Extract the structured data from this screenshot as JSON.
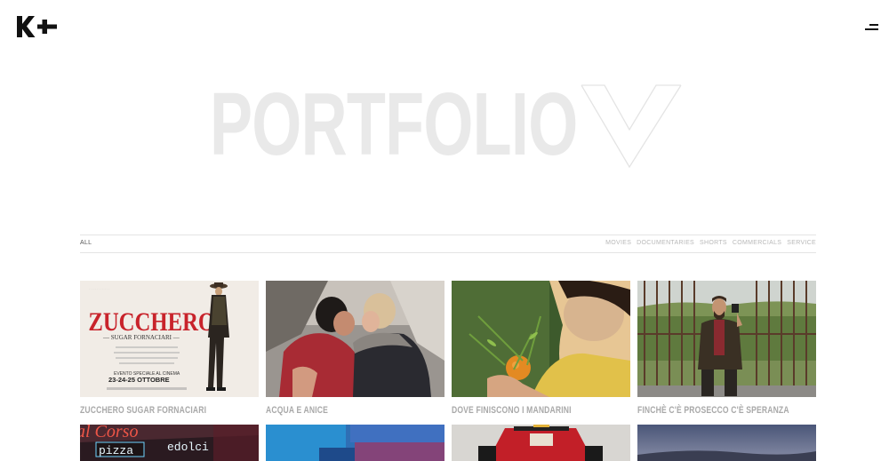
{
  "header": {
    "logo_alt": "K+",
    "menu_icon": "hamburger-icon"
  },
  "hero": {
    "title": "PORTFOLIO"
  },
  "filters": {
    "active": "ALL",
    "items": [
      "MOVIES",
      "DOCUMENTARIES",
      "SHORTS",
      "COMMERCIALS",
      "SERVICE"
    ]
  },
  "portfolio": {
    "items": [
      {
        "title": "ZUCCHERO SUGAR FORNACIARI",
        "poster": {
          "heading": "ZUCCHERO",
          "subheading": "— SUGAR FORNACIARI —",
          "event": "EVENTO SPECIALE AL CINEMA",
          "dates": "23-24-25 OTTOBRE"
        }
      },
      {
        "title": "ACQUA E ANICE"
      },
      {
        "title": "DOVE FINISCONO I MANDARINI"
      },
      {
        "title": "FINCHÈ C'È PROSECCO C'È SPERANZA"
      },
      {
        "title": "",
        "sign": {
          "line1": "pizza",
          "line2": "edolci"
        }
      },
      {
        "title": ""
      },
      {
        "title": ""
      },
      {
        "title": ""
      }
    ]
  }
}
